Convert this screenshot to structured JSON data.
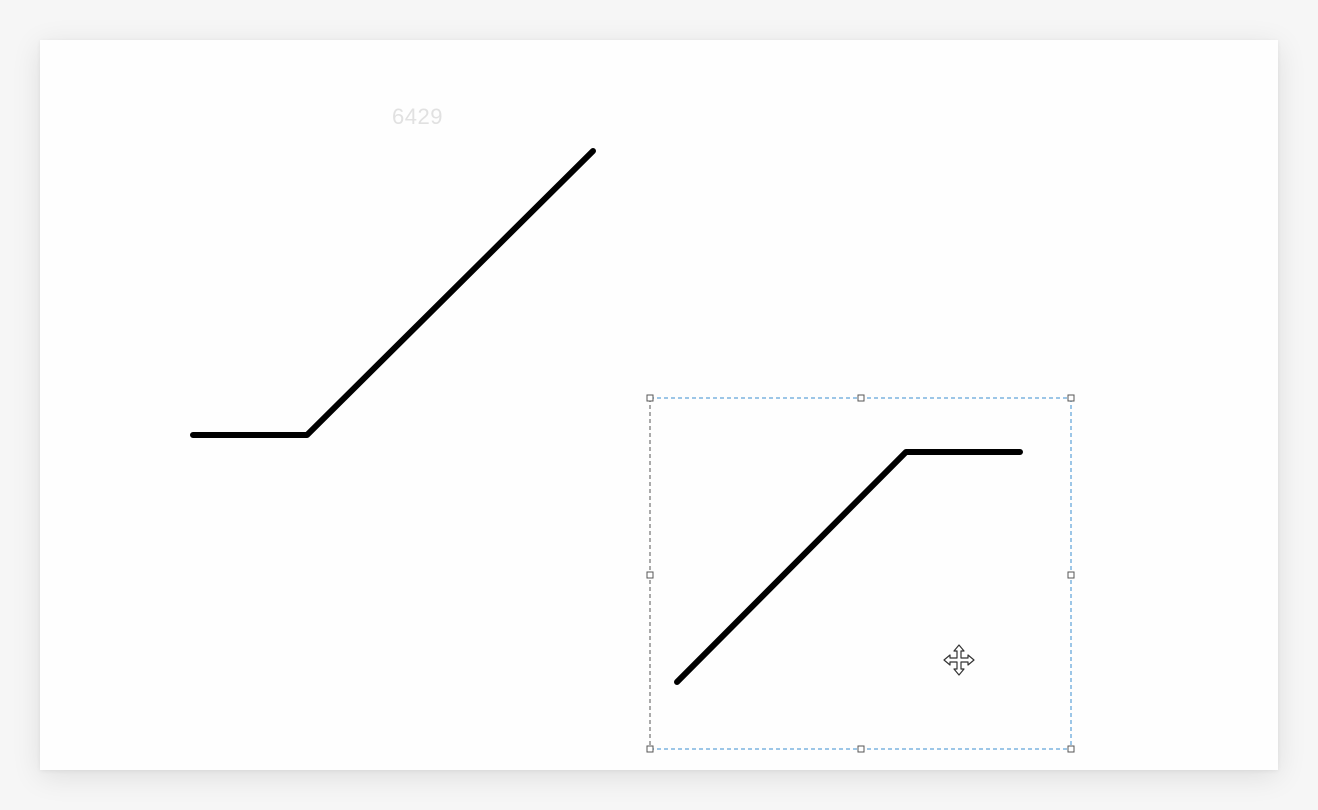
{
  "canvas": {
    "watermark_text": "6429"
  },
  "selection": {
    "border_color_top_right": "#3a8fd0",
    "border_color_left": "#555555",
    "state": "selected"
  },
  "cursor": {
    "icon": "move-cursor-icon"
  }
}
